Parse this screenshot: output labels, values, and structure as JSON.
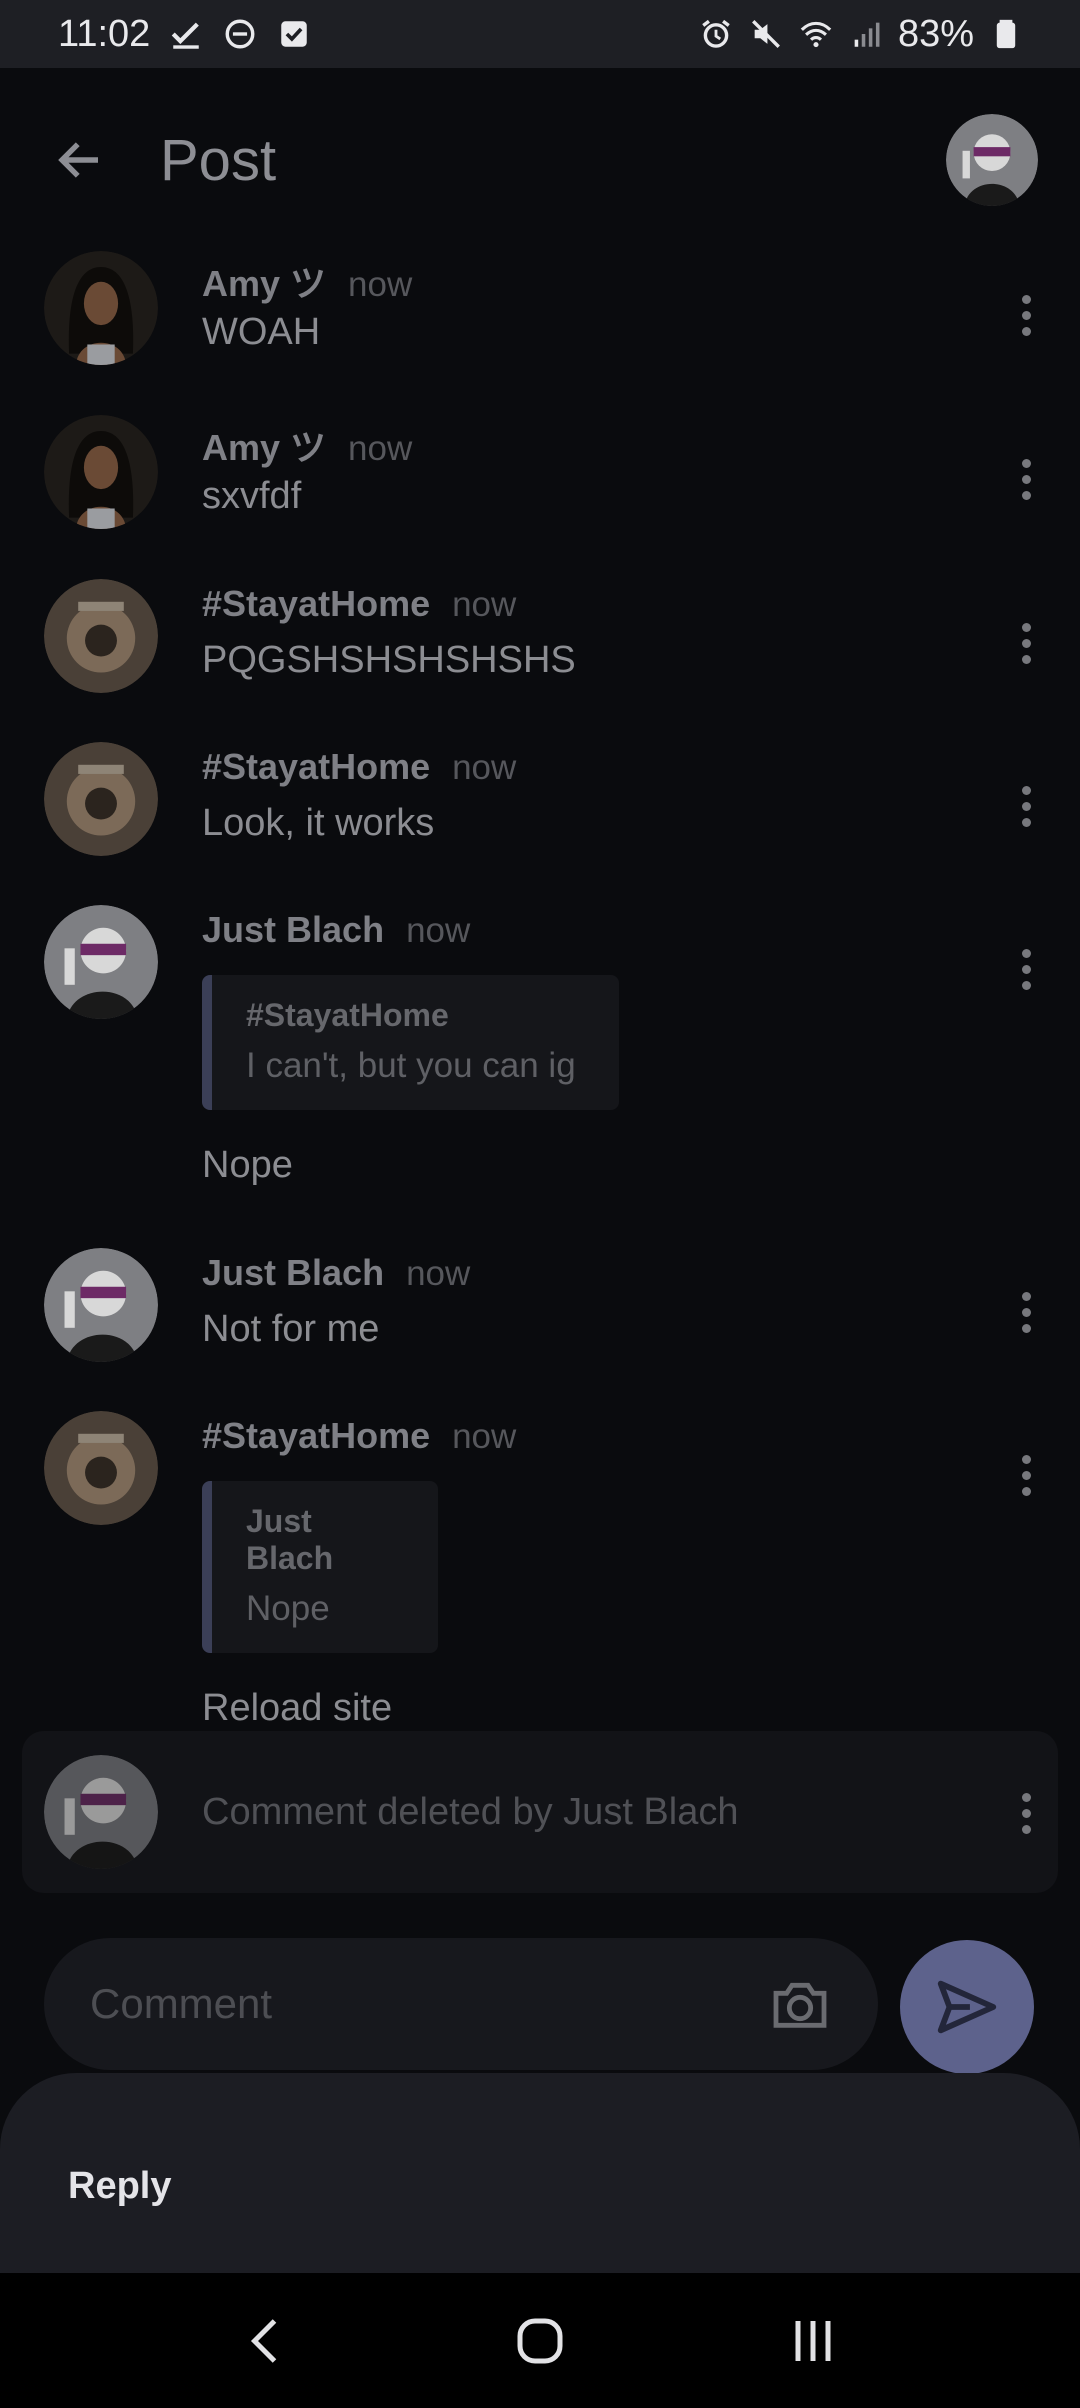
{
  "status_bar": {
    "time": "11:02",
    "battery": "83%",
    "left_icons": [
      "check-icon",
      "do-not-disturb-icon",
      "checkbox-icon"
    ],
    "right_icons": [
      "alarm-icon",
      "mute-icon",
      "wifi-icon",
      "signal-icon",
      "battery-icon"
    ]
  },
  "header": {
    "title": "Post"
  },
  "comments": [
    {
      "author": "Amy ツ",
      "time": "now",
      "text": "WOAH",
      "avatar": "amy"
    },
    {
      "author": "Amy ツ",
      "time": "now",
      "text": "sxvfdf",
      "avatar": "amy"
    },
    {
      "author": "#StayatHome",
      "time": "now",
      "text": "PQGSHSHSHSHSHS",
      "avatar": "stayathome"
    },
    {
      "author": "#StayatHome",
      "time": "now",
      "text": "Look, it works",
      "avatar": "stayathome"
    },
    {
      "author": "Just Blach",
      "time": "now",
      "quote": {
        "author": "#StayatHome",
        "text": "I can't, but you can ig"
      },
      "text": "Nope",
      "avatar": "blach"
    },
    {
      "author": "Just Blach",
      "time": "now",
      "text": "Not for me",
      "avatar": "blach"
    },
    {
      "author": "#StayatHome",
      "time": "now",
      "quote": {
        "author": "Just Blach",
        "text": "Nope"
      },
      "text": "Reload site",
      "avatar": "stayathome"
    }
  ],
  "deleted_comment": {
    "text": "Comment deleted by Just Blach"
  },
  "composer": {
    "placeholder": "Comment"
  },
  "sheet": {
    "action": "Reply"
  },
  "colors": {
    "background": "#0a0b0e",
    "accent": "#5d628c",
    "quote_bar": "#3b3f57"
  }
}
